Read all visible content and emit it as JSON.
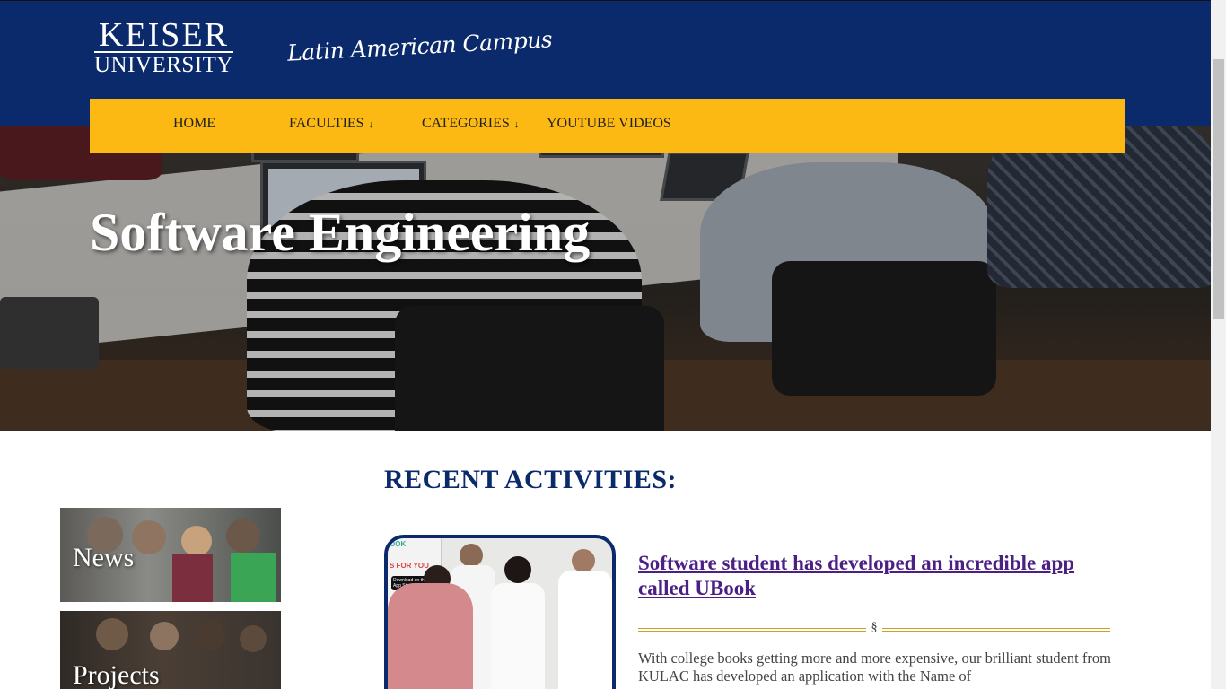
{
  "logo": {
    "line1": "KEISER",
    "line2": "UNIVERSITY",
    "campus": "Latin American Campus"
  },
  "nav": {
    "items": [
      {
        "label": "HOME",
        "dropdown": false
      },
      {
        "label": "FACULTIES",
        "dropdown": true
      },
      {
        "label": "CATEGORIES",
        "dropdown": true
      },
      {
        "label": "YOUTUBE VIDEOS",
        "dropdown": false
      }
    ],
    "arrow": "↓"
  },
  "hero": {
    "title": "Software Engineering"
  },
  "sidebar": {
    "cards": [
      {
        "label": "News"
      },
      {
        "label": "Projects"
      }
    ]
  },
  "main": {
    "section_title": "RECENT ACTIVITIES:",
    "post": {
      "title": "Software student has developed an incredible app called UBook",
      "divider_symbol": "§",
      "excerpt": "With college books getting more and more expensive, our brilliant student from KULAC has developed an application with the Name of",
      "image_poster_top": "OOK",
      "image_poster_text": "S FOR YOU",
      "image_appstore": "Download on the App Store"
    }
  },
  "colors": {
    "navy": "#0a2a6b",
    "gold": "#fdb913",
    "link_purple": "#4b1f84"
  }
}
